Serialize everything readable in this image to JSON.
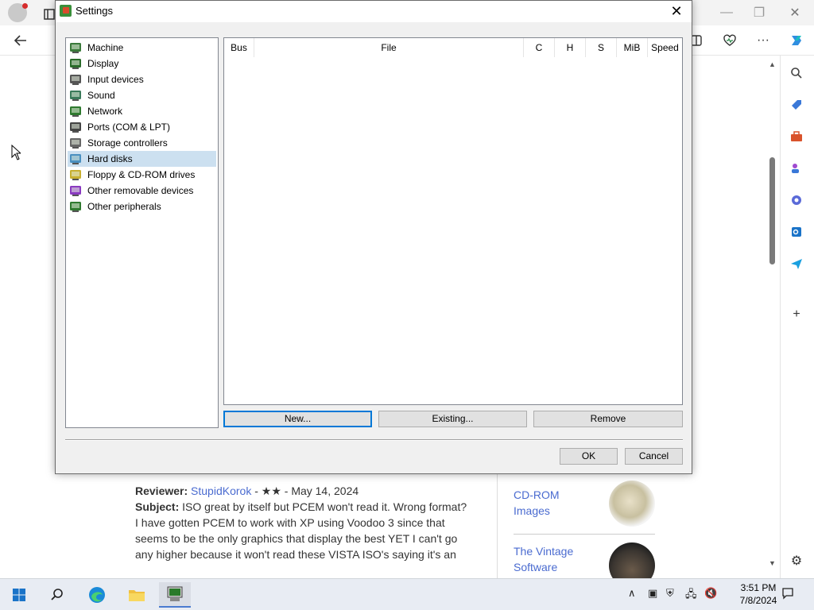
{
  "dialog": {
    "title": "Settings",
    "close_glyph": "✕",
    "tree": [
      {
        "label": "Machine",
        "icon": "machine-icon",
        "color": "#3a7a3a"
      },
      {
        "label": "Display",
        "icon": "display-icon",
        "color": "#2a6b2a"
      },
      {
        "label": "Input devices",
        "icon": "input-devices-icon",
        "color": "#555555"
      },
      {
        "label": "Sound",
        "icon": "sound-icon",
        "color": "#3a7a5a"
      },
      {
        "label": "Network",
        "icon": "network-icon",
        "color": "#2f7a2f"
      },
      {
        "label": "Ports (COM & LPT)",
        "icon": "ports-icon",
        "color": "#444444"
      },
      {
        "label": "Storage controllers",
        "icon": "storage-controllers-icon",
        "color": "#666666"
      },
      {
        "label": "Hard disks",
        "icon": "hard-disk-icon",
        "color": "#4a90c0"
      },
      {
        "label": "Floppy & CD-ROM drives",
        "icon": "floppy-cdrom-icon",
        "color": "#c8b030"
      },
      {
        "label": "Other removable devices",
        "icon": "removable-devices-icon",
        "color": "#8a3ac0"
      },
      {
        "label": "Other peripherals",
        "icon": "peripherals-icon",
        "color": "#2f7a2f"
      }
    ],
    "selected_index": 7,
    "columns": [
      "Bus",
      "File",
      "C",
      "H",
      "S",
      "MiB",
      "Speed"
    ],
    "buttons": {
      "new": "New...",
      "existing": "Existing...",
      "remove": "Remove",
      "ok": "OK",
      "cancel": "Cancel"
    }
  },
  "page": {
    "reviewer_label": "Reviewer:",
    "reviewer_name": "StupidKorok",
    "reviewer_meta": " - ★★ - May 14, 2024",
    "subject_label": "Subject:",
    "subject_text": " ISO great by itself but PCEM won't read it. Wrong format?",
    "body_text": "I have gotten PCEM to work with XP using Voodoo 3 since that seems to be the only graphics that display the best YET I can't go any higher because it won't read these VISTA ISO's saying it's an",
    "related": [
      {
        "label": "CD-ROM Images"
      },
      {
        "label": "The Vintage Software"
      }
    ]
  },
  "taskbar": {
    "time": "3:51 PM",
    "date": "7/8/2024"
  }
}
